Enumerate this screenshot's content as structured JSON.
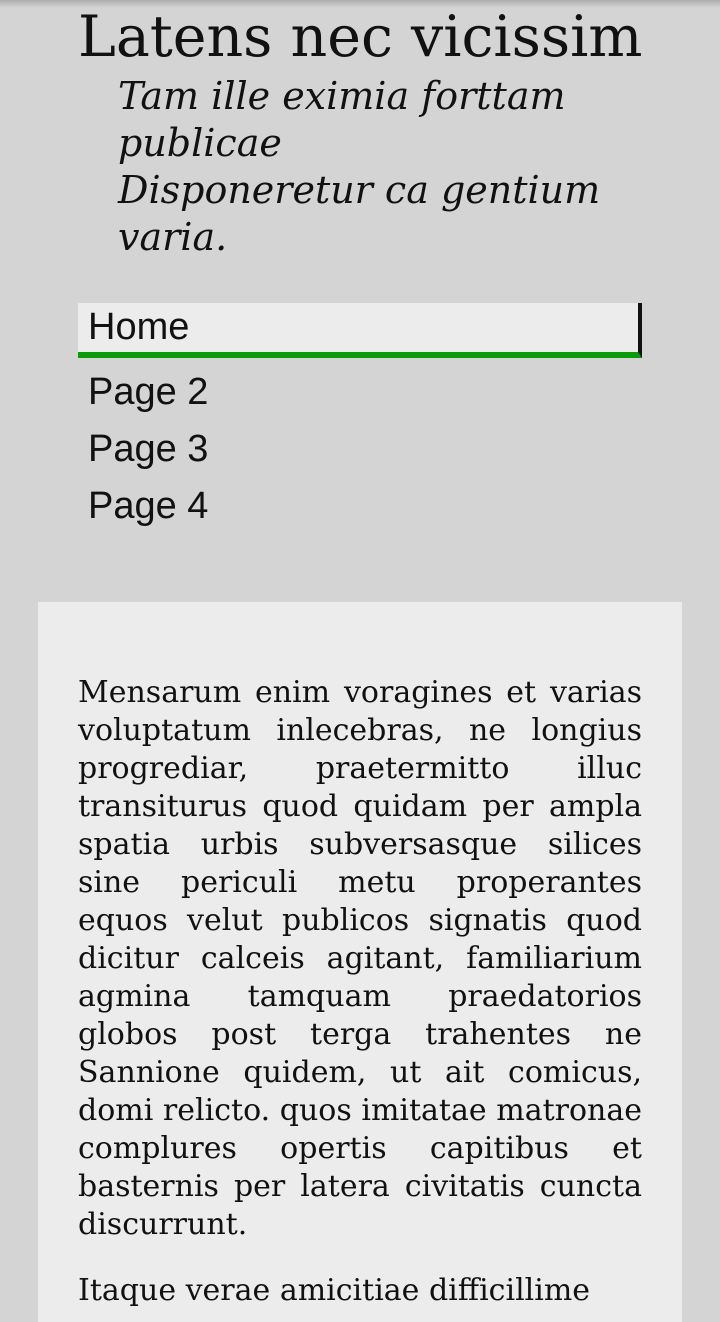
{
  "header": {
    "title": "Latens nec vicissim",
    "tagline_line1": "Tam ille eximia forttam publicae",
    "tagline_line2": "Disponeretur ca gentium varia."
  },
  "nav": {
    "items": [
      {
        "label": "Home",
        "active": true
      },
      {
        "label": "Page 2",
        "active": false
      },
      {
        "label": "Page 3",
        "active": false
      },
      {
        "label": "Page 4",
        "active": false
      }
    ]
  },
  "colors": {
    "page_background": "#d4d4d4",
    "content_background": "#ececec",
    "active_accent": "#0a9a0a"
  },
  "main": {
    "paragraphs": [
      "Mensarum enim voragines et varias voluptatum inlecebras, ne longius progrediar, praetermitto illuc transiturus quod quidam per ampla spatia urbis subversasque silices sine periculi metu properantes equos velut publicos signatis quod dicitur calceis agitant, familiarium agmina tamquam praedatorios globos post terga trahentes ne Sannione quidem, ut ait comicus, domi relicto. quos imitatae matronae complures opertis capitibus et basternis per latera civitatis cuncta discurrunt.",
      "Itaque verae amicitiae difficillime"
    ]
  }
}
